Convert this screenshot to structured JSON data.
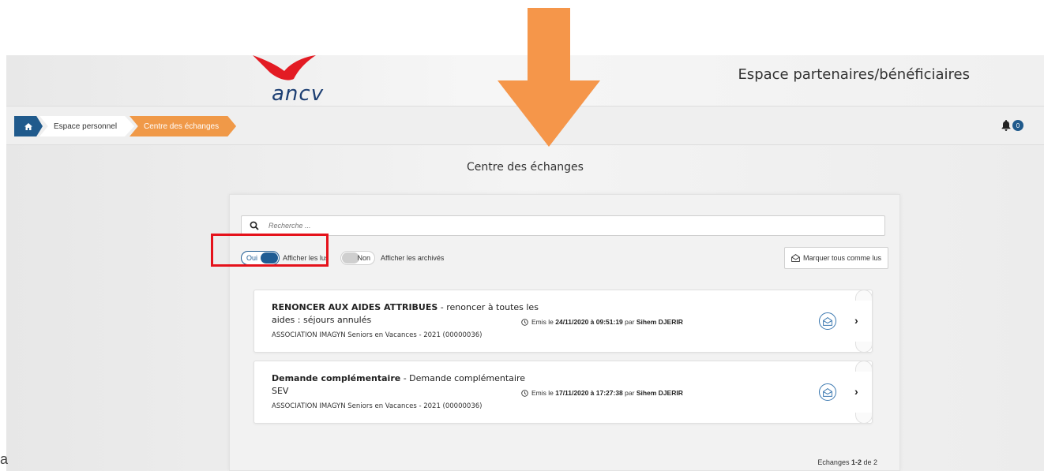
{
  "header": {
    "logo_text": "ancv",
    "title": "Espace partenaires/bénéficiaires"
  },
  "breadcrumb": {
    "home_icon": "home-icon",
    "items": [
      "Espace personnel",
      "Centre des échanges"
    ]
  },
  "notifications": {
    "count": "0"
  },
  "page_title": "Centre des échanges",
  "search": {
    "placeholder": "Recherche ..."
  },
  "filters": {
    "show_read": {
      "state": "Oui",
      "label": "Afficher les lus"
    },
    "show_archived": {
      "state": "Non",
      "label": "Afficher les archivés"
    }
  },
  "mark_all_read": {
    "label": "Marquer tous comme lus"
  },
  "exchanges": [
    {
      "subject": "RENONCER AUX AIDES ATTRIBUES",
      "summary": " - renoncer à toutes les aides : séjours annulés",
      "association": "ASSOCIATION IMAGYN Seniors en Vacances - 2021 (00000036)",
      "emitted_prefix": "Emis le ",
      "emitted_date": "24/11/2020 à 09:51:19",
      "by_prefix": " par ",
      "author": "Sihem DJERIR"
    },
    {
      "subject": "Demande complémentaire",
      "summary": " - Demande complémentaire SEV",
      "association": "ASSOCIATION IMAGYN Seniors en Vacances - 2021 (00000036)",
      "emitted_prefix": "Emis le ",
      "emitted_date": "17/11/2020 à 17:27:38",
      "by_prefix": " par ",
      "author": "Sihem DJERIR"
    }
  ],
  "pagination": {
    "prefix": "Echanges ",
    "range": "1-2",
    "suffix": " de 2"
  },
  "corner_text": "a",
  "colors": {
    "primary": "#205a8c",
    "accent": "#f09948",
    "annotation_arrow": "#f5964a",
    "annotation_box": "#e5121b",
    "logo_bird": "#e31b23"
  }
}
